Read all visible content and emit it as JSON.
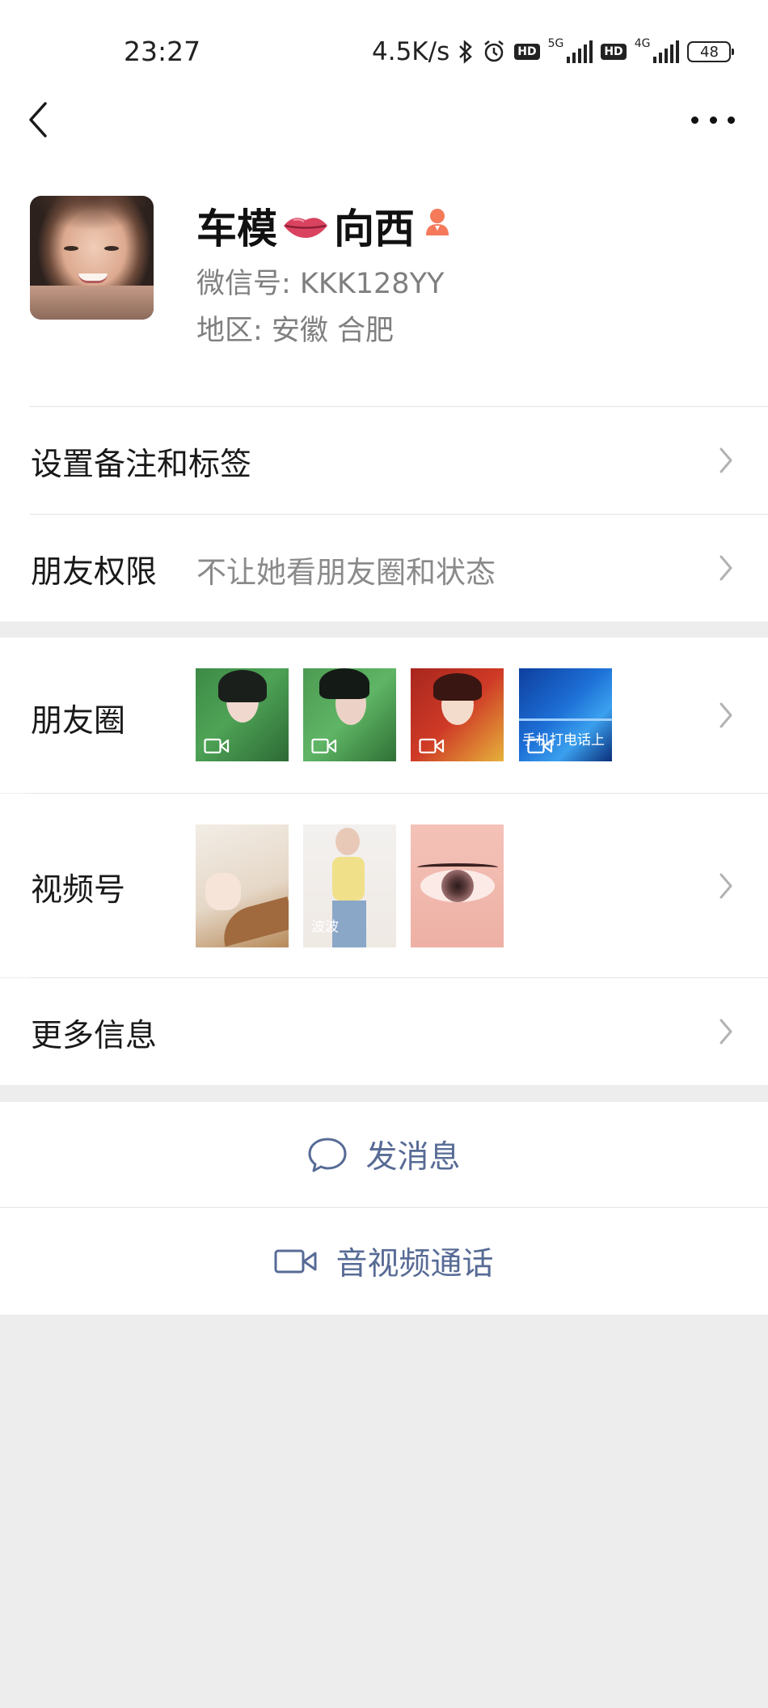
{
  "status_bar": {
    "time": "23:27",
    "net_speed": "4.5K/s",
    "sim1_gen": "5G",
    "sim2_gen": "4G",
    "hd_label": "HD",
    "battery": "48"
  },
  "profile": {
    "nickname_part1": "车模",
    "nickname_part2": "向西",
    "wechat_id": "微信号:  KKK128YY",
    "region": "地区:  安徽   合肥",
    "gender": "female"
  },
  "menu": {
    "remark_label": "设置备注和标签",
    "permission_label": "朋友权限",
    "permission_value": "不让她看朋友圈和状态",
    "moments_label": "朋友圈",
    "channels_label": "视频号",
    "more_info_label": "更多信息"
  },
  "moments": {
    "thumb4_caption": "手机打电话上"
  },
  "channels": {
    "thumb2_caption": "波波"
  },
  "actions": {
    "message_label": "发消息",
    "call_label": "音视频通话"
  },
  "colors": {
    "link_blue": "#576b95",
    "page_bg": "#ededed",
    "gender_orange": "#f47a5a"
  }
}
